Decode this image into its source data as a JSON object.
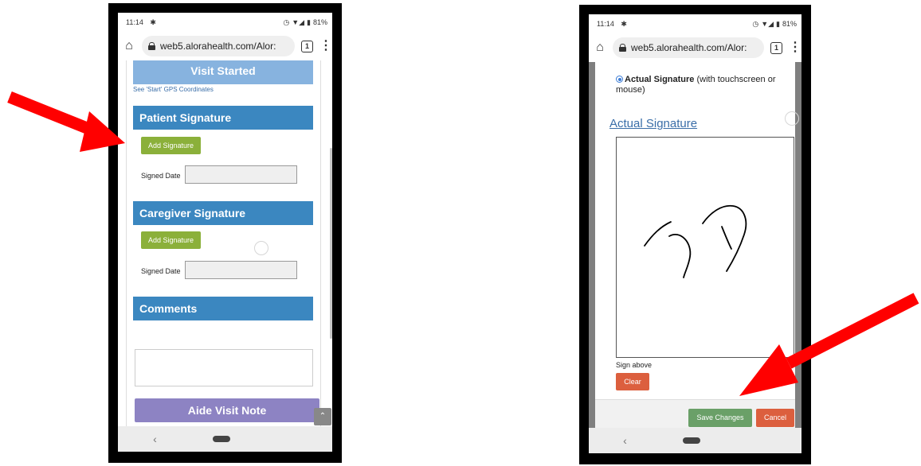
{
  "left_phone": {
    "status": {
      "time": "11:14",
      "battery": "81%"
    },
    "browser": {
      "url": "web5.alorahealth.com/Alor:",
      "tab_count": "1"
    },
    "visit_started_label": "Visit Started",
    "gps_link": "See 'Start' GPS Coordinates",
    "patient_signature": {
      "title": "Patient Signature",
      "button": "Add Signature",
      "date_label": "Signed Date"
    },
    "caregiver_signature": {
      "title": "Caregiver Signature",
      "button": "Add Signature",
      "date_label": "Signed Date"
    },
    "comments": {
      "title": "Comments"
    },
    "aide_visit_note": "Aide Visit Note",
    "scroll_top_glyph": "⌃",
    "nav_back": "‹"
  },
  "right_phone": {
    "status": {
      "time": "11:14",
      "battery": "81%"
    },
    "browser": {
      "url": "web5.alorahealth.com/Alor:",
      "tab_count": "1"
    },
    "radio_label_bold": "Actual Signature",
    "radio_label_rest": " (with touchscreen or mouse)",
    "signature_link": "Actual Signature",
    "sign_above": "Sign above",
    "clear_button": "Clear",
    "save_button": "Save Changes",
    "cancel_button": "Cancel",
    "nav_back": "‹"
  },
  "colors": {
    "arrow": "#ff0000",
    "section_header": "#3b87c0",
    "green_button": "#8bb03a",
    "save_button": "#6aa068",
    "cancel_button": "#dc5f3e",
    "purple_button": "#8d83c3"
  },
  "icons": [
    "home-icon",
    "lock-icon",
    "tab-switcher-icon",
    "kebab-menu-icon",
    "android-icon",
    "alarm-icon",
    "wifi-icon",
    "signal-icon",
    "battery-icon",
    "radio-selected-icon",
    "scroll-to-top-icon",
    "back-nav-icon",
    "home-nav-icon",
    "red-arrow-annotation"
  ]
}
